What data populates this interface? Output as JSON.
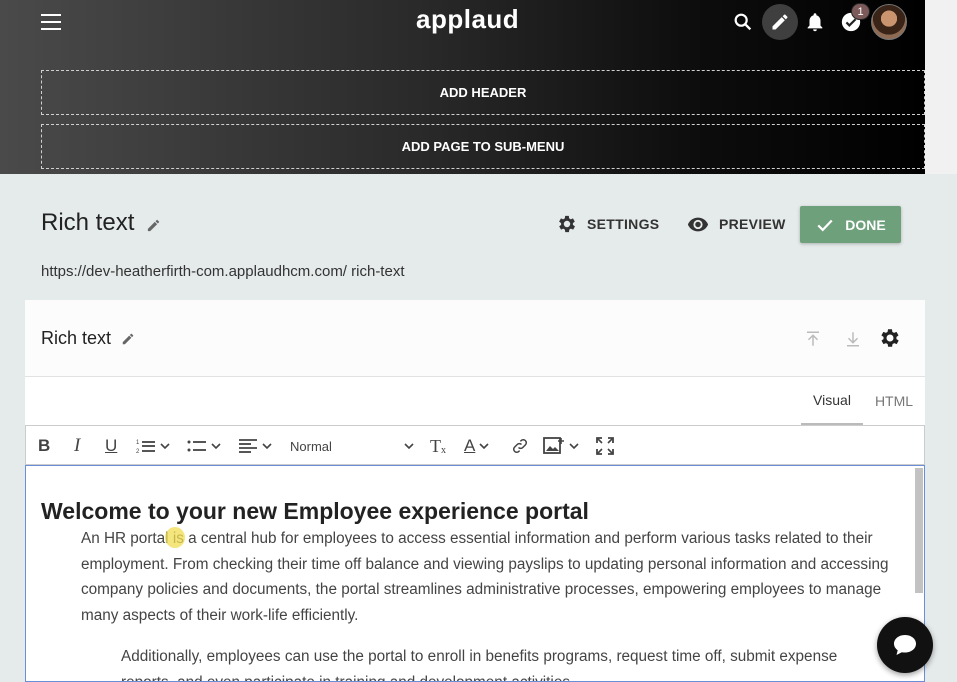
{
  "header": {
    "logo": "applaud",
    "notification_count": "1",
    "add_header_label": "ADD HEADER",
    "add_submenu_label": "ADD PAGE TO SUB-MENU"
  },
  "page": {
    "title": "Rich text",
    "url": "https://dev-heatherfirth-com.applaudhcm.com/ rich-text",
    "settings_label": "SETTINGS",
    "preview_label": "PREVIEW",
    "done_label": "DONE"
  },
  "component": {
    "title": "Rich text",
    "tabs": [
      {
        "label": "Visual",
        "active": true
      },
      {
        "label": "HTML",
        "active": false
      }
    ]
  },
  "toolbar": {
    "bold": "B",
    "italic": "I",
    "underline": "U",
    "format_value": "Normal",
    "clear_format": "T",
    "text_color": "A"
  },
  "editor": {
    "heading": "Welcome to your new Employee experience portal",
    "paragraph1": "An HR portal is a central hub for employees to access essential information and perform various tasks related to their employment. From checking their time off balance and viewing payslips to updating personal information and accessing company policies and documents, the portal streamlines administrative processes, empowering employees to manage many aspects of their work-life efficiently.",
    "paragraph2": "Additionally, employees can use the portal to enroll in benefits programs, request time off, submit expense reports, and even participate in training and development activities."
  },
  "colors": {
    "done_button": "#6ea07b",
    "editor_focus_border": "#6a8fd8",
    "badge": "#7c5a5a"
  },
  "icons": [
    "menu-icon",
    "search-icon",
    "pencil-icon",
    "bell-icon",
    "check-circle-icon",
    "gear-icon",
    "eye-icon",
    "check-icon",
    "move-top-icon",
    "move-bottom-icon",
    "ordered-list-icon",
    "bullet-list-icon",
    "align-icon",
    "link-icon",
    "image-icon",
    "fullscreen-icon",
    "chat-icon"
  ]
}
